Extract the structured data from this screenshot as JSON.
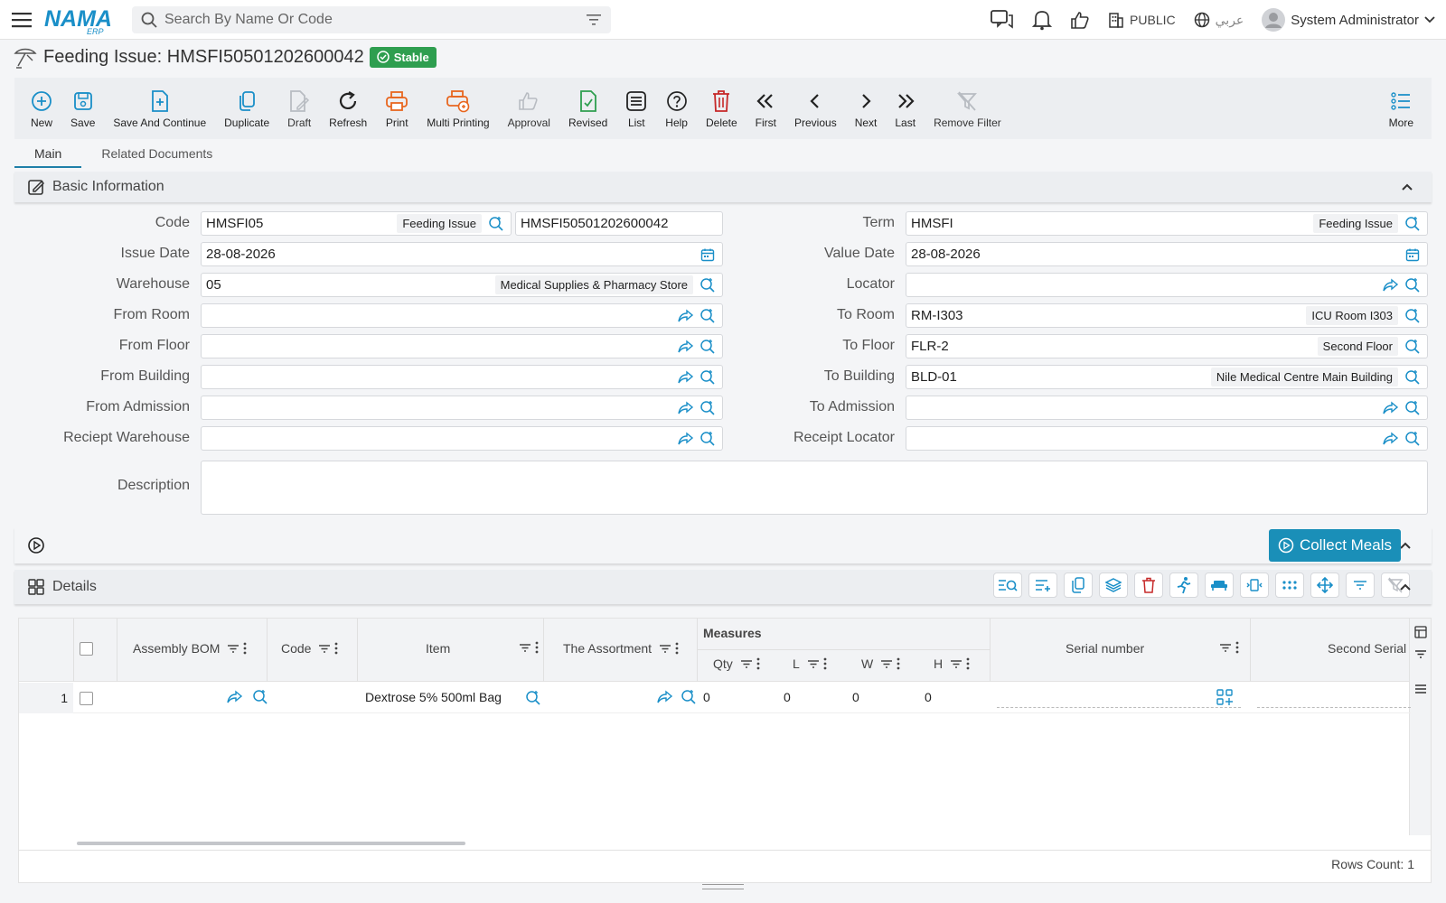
{
  "topbar": {
    "search_placeholder": "Search By Name Or Code",
    "org": "PUBLIC",
    "language": "عربي",
    "user": "System Administrator",
    "logo_text": "NAMA",
    "logo_sub": "ERP"
  },
  "page": {
    "title": "Feeding Issue: HMSFI50501202600042",
    "status": "Stable"
  },
  "toolbar": [
    {
      "label": "New",
      "icon": "plus-circle-icon"
    },
    {
      "label": "Save",
      "icon": "save-icon"
    },
    {
      "label": "Save And Continue",
      "icon": "save-continue-icon"
    },
    {
      "label": "Duplicate",
      "icon": "duplicate-icon"
    },
    {
      "label": "Draft",
      "icon": "draft-icon"
    },
    {
      "label": "Refresh",
      "icon": "refresh-icon"
    },
    {
      "label": "Print",
      "icon": "print-icon"
    },
    {
      "label": "Multi Printing",
      "icon": "multi-print-icon"
    },
    {
      "label": "Approval",
      "icon": "thumb-up-icon"
    },
    {
      "label": "Revised",
      "icon": "revised-icon"
    },
    {
      "label": "List",
      "icon": "list-icon"
    },
    {
      "label": "Help",
      "icon": "help-icon"
    },
    {
      "label": "Delete",
      "icon": "trash-icon"
    },
    {
      "label": "First",
      "icon": "first-icon"
    },
    {
      "label": "Previous",
      "icon": "previous-icon"
    },
    {
      "label": "Next",
      "icon": "next-icon"
    },
    {
      "label": "Last",
      "icon": "last-icon"
    },
    {
      "label": "Remove Filter",
      "icon": "remove-filter-icon"
    }
  ],
  "toolbar_more": "More",
  "tabs": [
    "Main",
    "Related Documents"
  ],
  "basic_info": {
    "title": "Basic Information",
    "left": [
      {
        "label": "Code",
        "value": "HMSFI05",
        "desc": "Feeding Issue",
        "value2": "HMSFI50501202600042"
      },
      {
        "label": "Issue Date",
        "value": "28-08-2026"
      },
      {
        "label": "Warehouse",
        "value": "05",
        "desc": "Medical Supplies & Pharmacy Store"
      },
      {
        "label": "From Room",
        "value": ""
      },
      {
        "label": "From Floor",
        "value": ""
      },
      {
        "label": "From Building",
        "value": ""
      },
      {
        "label": "From Admission",
        "value": ""
      },
      {
        "label": "Reciept Warehouse",
        "value": ""
      }
    ],
    "right": [
      {
        "label": "Term",
        "value": "HMSFI",
        "desc": "Feeding Issue"
      },
      {
        "label": "Value Date",
        "value": "28-08-2026"
      },
      {
        "label": "Locator",
        "value": ""
      },
      {
        "label": "To Room",
        "value": "RM-I303",
        "desc": "ICU Room I303"
      },
      {
        "label": "To Floor",
        "value": "FLR-2",
        "desc": "Second Floor"
      },
      {
        "label": "To Building",
        "value": "BLD-01",
        "desc": "Nile Medical Centre Main Building"
      },
      {
        "label": "To Admission",
        "value": ""
      },
      {
        "label": "Receipt Locator",
        "value": ""
      }
    ],
    "description_label": "Description",
    "description_value": ""
  },
  "collect_meals": "Collect Meals",
  "details": {
    "title": "Details",
    "columns": {
      "assembly_bom": "Assembly BOM",
      "code": "Code",
      "item": "Item",
      "assortment": "The Assortment",
      "measures": "Measures",
      "qty": "Qty",
      "l": "L",
      "w": "W",
      "h": "H",
      "serial": "Serial number",
      "second_serial": "Second Serial"
    },
    "rows": [
      {
        "num": "1",
        "assembly_bom": "",
        "code": "",
        "item": "Dextrose 5% 500ml Bag",
        "assortment": "",
        "qty": "0",
        "l": "0",
        "w": "0",
        "h": "0",
        "serial": "",
        "second_serial": ""
      }
    ],
    "rows_count": "Rows Count: 1"
  }
}
